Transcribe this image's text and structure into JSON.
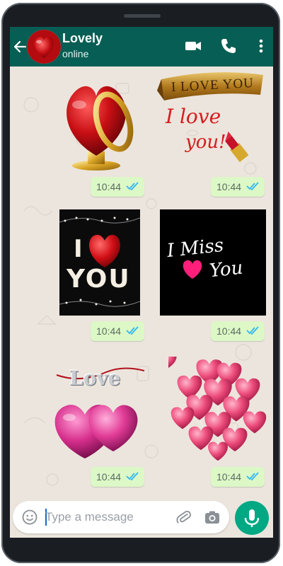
{
  "header": {
    "title": "Lovely",
    "status": "online"
  },
  "messages": [
    {
      "time": "10:44",
      "sticker": "red-heart-with-gold-ring"
    },
    {
      "time": "10:44",
      "sticker": "i-love-you-ribbon-lipstick",
      "texts": [
        "I LOVE YOU",
        "I love",
        "you!"
      ]
    },
    {
      "time": "10:44",
      "sticker": "i-love-you-pearls",
      "texts": [
        "I",
        "YOU"
      ]
    },
    {
      "time": "10:44",
      "sticker": "i-miss-you",
      "texts": [
        "I Miss",
        "You"
      ]
    },
    {
      "time": "10:44",
      "sticker": "love-two-pink-hearts",
      "texts": [
        "Love"
      ]
    },
    {
      "time": "10:44",
      "sticker": "pink-heart-balloons"
    }
  ],
  "composer": {
    "placeholder": "Type a message"
  },
  "colors": {
    "header": "#075e54",
    "bubble": "#dcf8c6",
    "chat_bg": "#ece5dd",
    "read_ticks": "#34b7f1",
    "mic": "#00a884"
  }
}
